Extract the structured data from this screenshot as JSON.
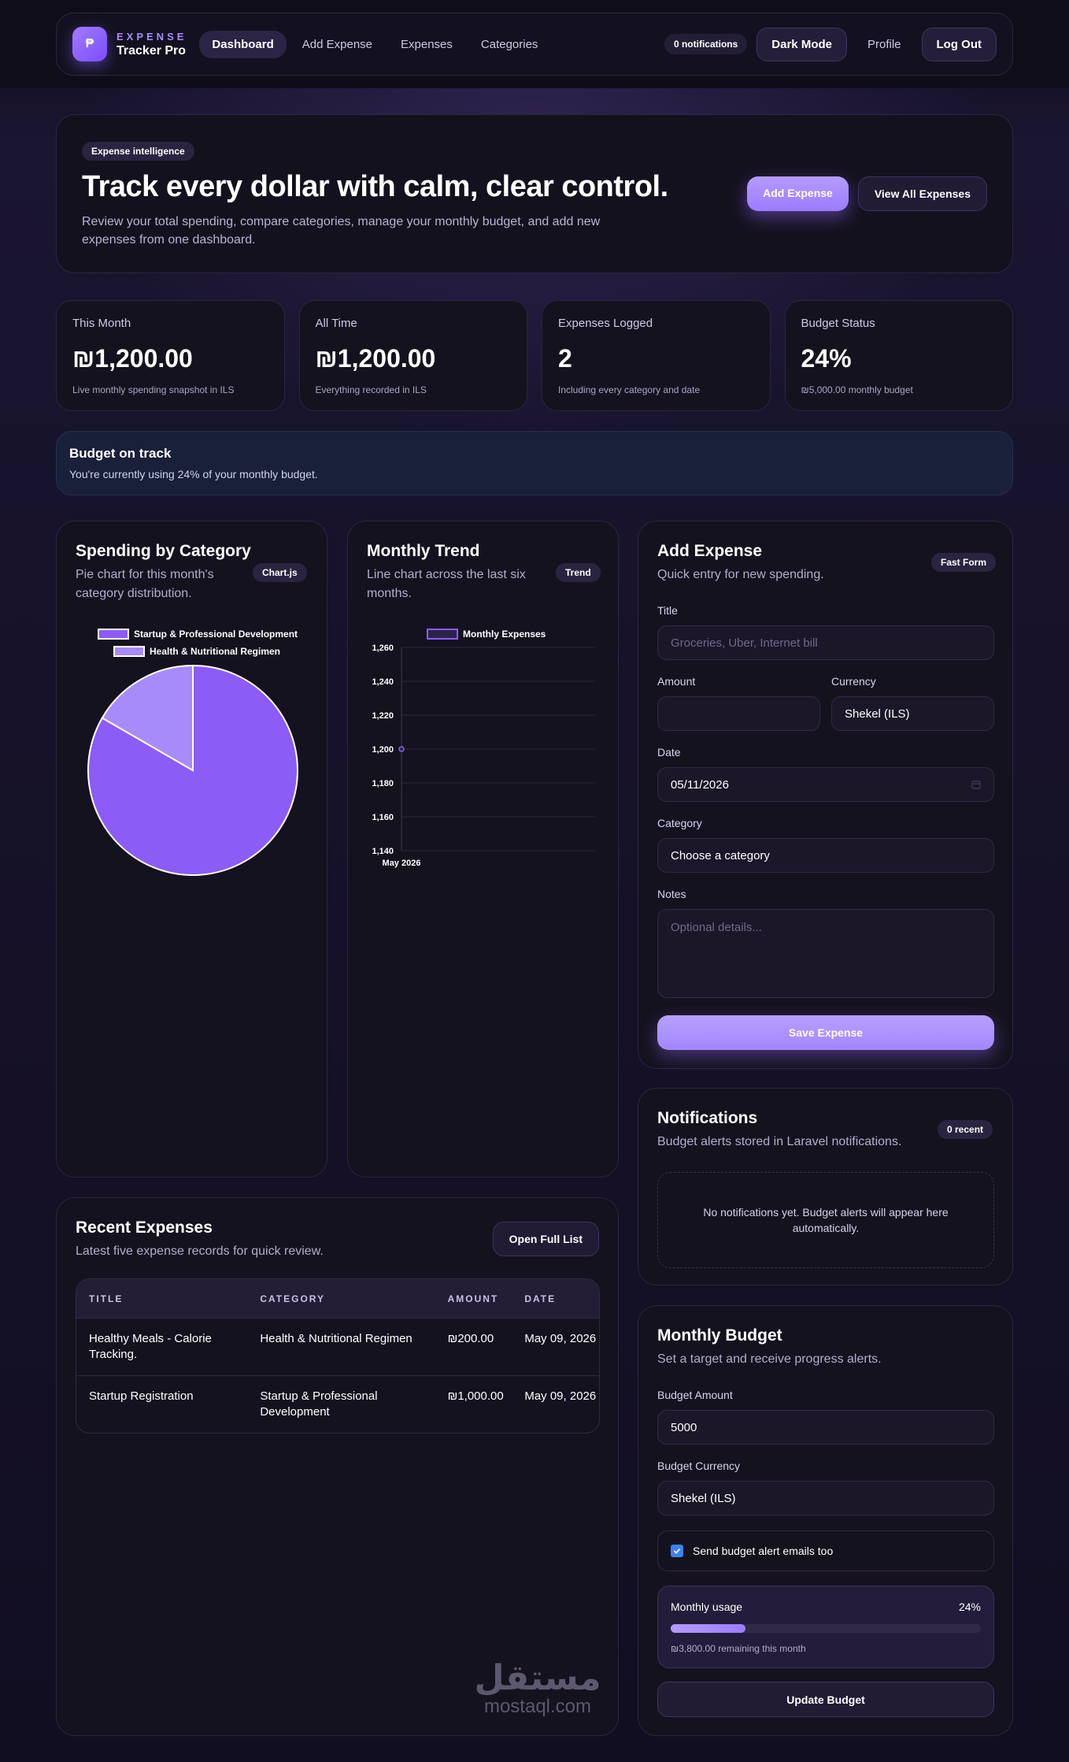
{
  "nav": {
    "logo_char": "₱",
    "brand_top": "EXPENSE",
    "brand_bottom": "Tracker Pro",
    "links": [
      {
        "label": "Dashboard",
        "active": true
      },
      {
        "label": "Add Expense"
      },
      {
        "label": "Expenses"
      },
      {
        "label": "Categories"
      }
    ],
    "notifications": "0 notifications",
    "dark_mode": "Dark Mode",
    "profile": "Profile",
    "logout": "Log Out"
  },
  "hero": {
    "pill": "Expense intelligence",
    "title": "Track every dollar with calm, clear control.",
    "desc": "Review your total spending, compare categories, manage your monthly budget, and add new expenses from one dashboard.",
    "add_btn": "Add Expense",
    "view_btn": "View All Expenses"
  },
  "stats": [
    {
      "label": "This Month",
      "value": "₪1,200.00",
      "sub": "Live monthly spending snapshot in ILS"
    },
    {
      "label": "All Time",
      "value": "₪1,200.00",
      "sub": "Everything recorded in ILS"
    },
    {
      "label": "Expenses Logged",
      "value": "2",
      "sub": "Including every category and date"
    },
    {
      "label": "Budget Status",
      "value": "24%",
      "sub": "₪5,000.00 monthly budget"
    }
  ],
  "alert": {
    "title": "Budget on track",
    "text": "You're currently using 24% of your monthly budget."
  },
  "category_card": {
    "title": "Spending by Category",
    "sub": "Pie chart for this month's category distribution.",
    "tag": "Chart.js"
  },
  "trend_card": {
    "title": "Monthly Trend",
    "sub": "Line chart across the last six months.",
    "tag": "Trend"
  },
  "chart_data": [
    {
      "type": "pie",
      "categories": [
        "Startup & Professional Development",
        "Health & Nutritional Regimen"
      ],
      "values": [
        1000,
        200
      ],
      "colors": [
        "#8b5cf6",
        "#a78bfa"
      ],
      "legend": "top"
    },
    {
      "type": "line",
      "x": [
        "May 2026"
      ],
      "series": [
        {
          "name": "Monthly Expenses",
          "values": [
            1200
          ]
        }
      ],
      "ylim": [
        1140,
        1260
      ],
      "yticks": [
        "1,260",
        "1,240",
        "1,220",
        "1,200",
        "1,180",
        "1,160",
        "1,140"
      ],
      "grid": true,
      "legend": "top",
      "color": "#8b5cf6"
    }
  ],
  "add_form": {
    "title": "Add Expense",
    "sub": "Quick entry for new spending.",
    "tag": "Fast Form",
    "title_label": "Title",
    "title_placeholder": "Groceries, Uber, Internet bill",
    "amount_label": "Amount",
    "amount_value": "",
    "currency_label": "Currency",
    "currency_value": "Shekel (ILS)",
    "date_label": "Date",
    "date_value": "05/11/2026",
    "category_label": "Category",
    "category_value": "Choose a category",
    "notes_label": "Notes",
    "notes_placeholder": "Optional details...",
    "save_btn": "Save Expense"
  },
  "notifications_card": {
    "title": "Notifications",
    "sub": "Budget alerts stored in Laravel notifications.",
    "tag": "0 recent",
    "empty": "No notifications yet. Budget alerts will appear here automatically."
  },
  "budget": {
    "title": "Monthly Budget",
    "sub": "Set a target and receive progress alerts.",
    "amount_label": "Budget Amount",
    "amount_value": "5000",
    "currency_label": "Budget Currency",
    "currency_value": "Shekel (ILS)",
    "email_label": "Send budget alert emails too",
    "email_checked": true,
    "usage_label": "Monthly usage",
    "usage_percent": "24%",
    "usage_fraction": 0.24,
    "remaining": "₪3,800.00 remaining this month",
    "update_btn": "Update Budget"
  },
  "recent": {
    "title": "Recent Expenses",
    "sub": "Latest five expense records for quick review.",
    "open_btn": "Open Full List",
    "headers": [
      "TITLE",
      "CATEGORY",
      "AMOUNT",
      "DATE"
    ],
    "rows": [
      [
        "Healthy Meals - Calorie Tracking.",
        "Health & Nutritional Regimen",
        "₪200.00",
        "May 09, 2026"
      ],
      [
        "Startup Registration",
        "Startup & Professional Development",
        "₪1,000.00",
        "May 09, 2026"
      ]
    ]
  },
  "watermark": {
    "arabic": "مستقل",
    "latin": "mostaql.com"
  }
}
